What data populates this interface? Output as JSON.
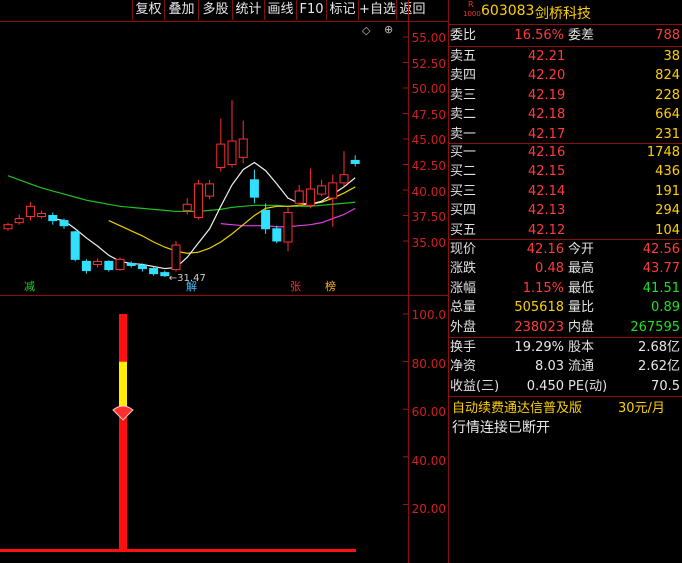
{
  "toolbar": {
    "buttons": [
      "复权",
      "叠加",
      "多股",
      "统计",
      "画线",
      "F10",
      "标记",
      "+自选",
      "返回"
    ]
  },
  "stock": {
    "badge_top": "R",
    "badge_bottom": "1000",
    "code": "603083",
    "name": "剑桥科技"
  },
  "order_ratio": {
    "label": "委比",
    "value": "16.56%",
    "diff_label": "委差",
    "diff_value": "788"
  },
  "asks": [
    {
      "label": "卖五",
      "price": "42.21",
      "vol": "38"
    },
    {
      "label": "卖四",
      "price": "42.20",
      "vol": "824"
    },
    {
      "label": "卖三",
      "price": "42.19",
      "vol": "228"
    },
    {
      "label": "卖二",
      "price": "42.18",
      "vol": "664"
    },
    {
      "label": "卖一",
      "price": "42.17",
      "vol": "231"
    }
  ],
  "bids": [
    {
      "label": "买一",
      "price": "42.16",
      "vol": "1748"
    },
    {
      "label": "买二",
      "price": "42.15",
      "vol": "436"
    },
    {
      "label": "买三",
      "price": "42.14",
      "vol": "191"
    },
    {
      "label": "买四",
      "price": "42.13",
      "vol": "294"
    },
    {
      "label": "买五",
      "price": "42.12",
      "vol": "104"
    }
  ],
  "quote": [
    {
      "l1": "现价",
      "v1": "42.16",
      "c1": "red",
      "l2": "今开",
      "v2": "42.56",
      "c2": "red"
    },
    {
      "l1": "涨跌",
      "v1": "0.48",
      "c1": "red",
      "l2": "最高",
      "v2": "43.77",
      "c2": "red"
    },
    {
      "l1": "涨幅",
      "v1": "1.15%",
      "c1": "red",
      "l2": "最低",
      "v2": "41.51",
      "c2": "grn"
    },
    {
      "l1": "总量",
      "v1": "505618",
      "c1": "yel",
      "l2": "量比",
      "v2": "0.89",
      "c2": "grn"
    },
    {
      "l1": "外盘",
      "v1": "238023",
      "c1": "red",
      "l2": "内盘",
      "v2": "267595",
      "c2": "grn"
    }
  ],
  "fundamentals": [
    {
      "l1": "换手",
      "v1": "19.29%",
      "l2": "股本",
      "v2": "2.68亿"
    },
    {
      "l1": "净资",
      "v1": "8.03",
      "l2": "流通",
      "v2": "2.62亿"
    },
    {
      "l1": "收益(三)",
      "v1": "0.450",
      "l2": "PE(动)",
      "v2": "70.5"
    }
  ],
  "promo": {
    "text": "自动续费通达信普及版",
    "price": "30元/月"
  },
  "status": "行情连接已断开",
  "price_axis": [
    "55.00",
    "52.50",
    "50.00",
    "47.50",
    "45.00",
    "42.50",
    "40.00",
    "37.50",
    "35.00"
  ],
  "indicator_axis": [
    "100.0",
    "80.00",
    "60.00",
    "40.00",
    "20.00"
  ],
  "low_label": "31.47",
  "markers": [
    {
      "text": "减",
      "color": "#20d020"
    },
    {
      "text": "解",
      "color": "#40c0ff"
    },
    {
      "text": "张",
      "color": "#ff3030"
    },
    {
      "text": "榜",
      "color": "#ffb020"
    }
  ],
  "candles": [
    {
      "o": 36.2,
      "c": 36.6,
      "h": 36.8,
      "l": 36.0
    },
    {
      "o": 36.8,
      "c": 37.2,
      "h": 37.6,
      "l": 36.6
    },
    {
      "o": 37.4,
      "c": 38.4,
      "h": 38.8,
      "l": 37.0
    },
    {
      "o": 37.4,
      "c": 37.7,
      "h": 38.0,
      "l": 37.2
    },
    {
      "o": 37.5,
      "c": 37.0,
      "h": 37.8,
      "l": 36.6
    },
    {
      "o": 37.0,
      "c": 36.5,
      "h": 37.2,
      "l": 36.2
    },
    {
      "o": 35.9,
      "c": 33.2,
      "h": 36.0,
      "l": 33.0
    },
    {
      "o": 33.0,
      "c": 32.1,
      "h": 33.2,
      "l": 31.8
    },
    {
      "o": 32.7,
      "c": 33.0,
      "h": 33.3,
      "l": 32.4
    },
    {
      "o": 33.0,
      "c": 32.2,
      "h": 33.1,
      "l": 32.0
    },
    {
      "o": 32.2,
      "c": 33.2,
      "h": 33.4,
      "l": 32.1
    },
    {
      "o": 32.8,
      "c": 32.6,
      "h": 33.0,
      "l": 32.4
    },
    {
      "o": 32.6,
      "c": 32.3,
      "h": 32.8,
      "l": 32.0
    },
    {
      "o": 32.3,
      "c": 31.8,
      "h": 32.5,
      "l": 31.6
    },
    {
      "o": 31.9,
      "c": 31.6,
      "h": 32.1,
      "l": 31.47
    },
    {
      "o": 32.2,
      "c": 34.6,
      "h": 35.0,
      "l": 32.0
    },
    {
      "o": 38.0,
      "c": 38.6,
      "h": 39.2,
      "l": 37.6
    },
    {
      "o": 37.3,
      "c": 40.6,
      "h": 41.0,
      "l": 37.1
    },
    {
      "o": 39.4,
      "c": 40.6,
      "h": 41.0,
      "l": 39.1
    },
    {
      "o": 42.2,
      "c": 44.5,
      "h": 47.0,
      "l": 41.8
    },
    {
      "o": 42.5,
      "c": 44.8,
      "h": 48.8,
      "l": 42.2
    },
    {
      "o": 43.2,
      "c": 45.0,
      "h": 46.8,
      "l": 42.6
    },
    {
      "o": 41.0,
      "c": 39.3,
      "h": 42.0,
      "l": 38.7
    },
    {
      "o": 38.0,
      "c": 36.2,
      "h": 38.7,
      "l": 35.7
    },
    {
      "o": 36.2,
      "c": 35.0,
      "h": 36.5,
      "l": 34.8
    },
    {
      "o": 34.9,
      "c": 37.8,
      "h": 38.3,
      "l": 34.0
    },
    {
      "o": 38.7,
      "c": 39.9,
      "h": 40.5,
      "l": 38.4
    },
    {
      "o": 38.5,
      "c": 40.1,
      "h": 42.1,
      "l": 38.2
    },
    {
      "o": 39.6,
      "c": 40.4,
      "h": 41.0,
      "l": 39.4
    },
    {
      "o": 39.2,
      "c": 40.7,
      "h": 41.5,
      "l": 36.4
    },
    {
      "o": 40.7,
      "c": 41.5,
      "h": 43.8,
      "l": 40.4
    },
    {
      "o": 42.9,
      "c": 42.6,
      "h": 43.4,
      "l": 42.3
    }
  ],
  "ma_white": [
    null,
    null,
    null,
    null,
    37.2,
    37.0,
    36.2,
    35.3,
    34.5,
    33.6,
    33.0,
    32.8,
    32.7,
    32.5,
    32.3,
    32.4,
    33.4,
    34.8,
    36.2,
    38.4,
    40.5,
    42.0,
    42.7,
    41.9,
    40.6,
    39.2,
    38.7,
    38.6,
    38.9,
    39.6,
    40.3,
    41.2
  ],
  "ma_yellow": [
    null,
    null,
    null,
    null,
    null,
    null,
    null,
    null,
    null,
    37.0,
    36.5,
    36.0,
    35.5,
    34.9,
    34.4,
    34.0,
    33.8,
    33.9,
    34.3,
    34.9,
    35.7,
    36.6,
    37.5,
    38.2,
    38.4,
    38.4,
    38.5,
    38.6,
    38.8,
    39.2,
    39.7,
    40.3
  ],
  "ma_pink": [
    null,
    null,
    null,
    null,
    null,
    null,
    null,
    null,
    null,
    null,
    null,
    null,
    null,
    null,
    null,
    null,
    null,
    null,
    null,
    36.7,
    36.6,
    36.5,
    36.5,
    36.5,
    36.4,
    36.4,
    36.5,
    36.6,
    36.8,
    37.2,
    37.6,
    38.2
  ],
  "ma_green": [
    41.4,
    41.0,
    40.6,
    40.2,
    39.9,
    39.6,
    39.3,
    39.0,
    38.8,
    38.6,
    38.4,
    38.3,
    38.2,
    38.1,
    38.0,
    37.9,
    37.9,
    37.9,
    38.0,
    38.1,
    38.3,
    38.4,
    38.5,
    38.5,
    38.5,
    38.4,
    38.4,
    38.4,
    38.5,
    38.6,
    38.7,
    38.8
  ],
  "indicator": {
    "max": 100,
    "red_low": 0,
    "red_mid_start": 50,
    "yellow_from": 60,
    "yellow_to": 80,
    "red_top_from": 80,
    "level": 58
  }
}
